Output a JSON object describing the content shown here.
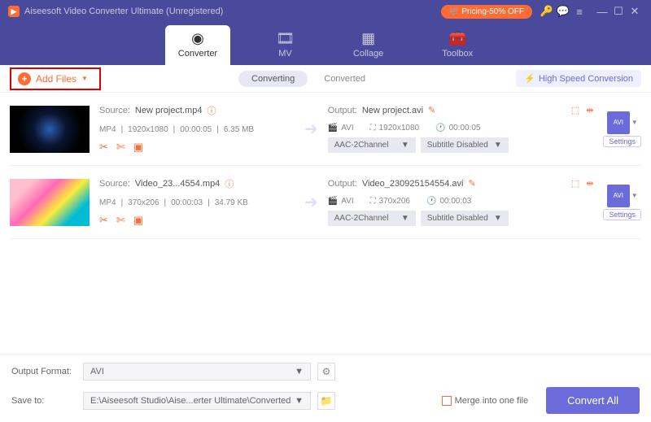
{
  "titlebar": {
    "title": "Aiseesoft Video Converter Ultimate (Unregistered)",
    "pricing": "Pricing-50% OFF"
  },
  "tabs": {
    "converter": "Converter",
    "mv": "MV",
    "collage": "Collage",
    "toolbox": "Toolbox"
  },
  "toolbar": {
    "add_files": "Add Files",
    "converting": "Converting",
    "converted": "Converted",
    "hsc": "High Speed Conversion"
  },
  "items": [
    {
      "source_label": "Source:",
      "source_name": "New project.mp4",
      "format": "MP4",
      "resolution": "1920x1080",
      "duration": "00:00:05",
      "size": "6.35 MB",
      "output_label": "Output:",
      "output_name": "New project.avi",
      "out_format": "AVI",
      "out_resolution": "1920x1080",
      "out_duration": "00:00:05",
      "audio": "AAC-2Channel",
      "subtitle": "Subtitle Disabled",
      "fmt_badge": "AVI",
      "settings": "Settings"
    },
    {
      "source_label": "Source:",
      "source_name": "Video_23...4554.mp4",
      "format": "MP4",
      "resolution": "370x206",
      "duration": "00:00:03",
      "size": "34.79 KB",
      "output_label": "Output:",
      "output_name": "Video_230925154554.avi",
      "out_format": "AVI",
      "out_resolution": "370x206",
      "out_duration": "00:00:03",
      "audio": "AAC-2Channel",
      "subtitle": "Subtitle Disabled",
      "fmt_badge": "AVI",
      "settings": "Settings"
    }
  ],
  "footer": {
    "output_format_label": "Output Format:",
    "output_format": "AVI",
    "save_to_label": "Save to:",
    "save_to": "E:\\Aiseesoft Studio\\Aise...erter Ultimate\\Converted",
    "merge": "Merge into one file",
    "convert": "Convert All"
  }
}
